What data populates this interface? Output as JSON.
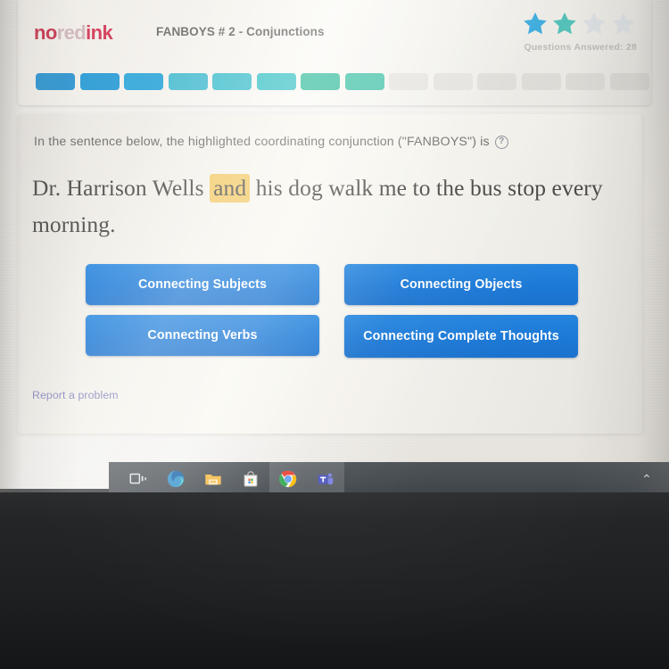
{
  "app": {
    "logo": {
      "part1": "no",
      "part2": "red",
      "part3": "ink"
    },
    "quiz_title": "FANBOYS # 2 - Conjunctions"
  },
  "score": {
    "questions_answered_label": "Questions Answered: 28",
    "stars_total": 4,
    "stars_filled": 2,
    "star_colors": [
      "#35a8db",
      "#4dbdb5",
      "#d9dde0",
      "#d9dde0"
    ]
  },
  "progress": {
    "total_segments": 14,
    "filled_segments": 8,
    "segment_colors": [
      "#2e94cf",
      "#2a9bd4",
      "#2fa6d8",
      "#49bcd0",
      "#45c0cd",
      "#40c3c6",
      "#3dbfa0",
      "#42c2a8",
      "#e5e3de",
      "#e3e1dc",
      "#dedcd7",
      "#dcdad5",
      "#dad8d3",
      "#d8d6d1"
    ]
  },
  "question": {
    "prompt": "In the sentence below, the highlighted coordinating conjunction (\"FANBOYS\") is",
    "help_icon_glyph": "?",
    "sentence_before": "Dr. Harrison Wells ",
    "sentence_highlight": "and",
    "sentence_after": " his dog walk me to the bus stop every morning.",
    "highlight_color": "#f2c964"
  },
  "answers": [
    {
      "label": "Connecting Subjects"
    },
    {
      "label": "Connecting Objects"
    },
    {
      "label": "Connecting Verbs"
    },
    {
      "label": "Connecting Complete Thoughts"
    }
  ],
  "answer_button_color": "#1c79d6",
  "footer": {
    "report_link": "Report a problem"
  },
  "taskbar": {
    "items": [
      {
        "name": "task-view",
        "active": false
      },
      {
        "name": "microsoft-edge",
        "active": false
      },
      {
        "name": "file-explorer",
        "active": false
      },
      {
        "name": "microsoft-store",
        "active": false
      },
      {
        "name": "google-chrome",
        "active": true
      },
      {
        "name": "microsoft-teams",
        "active": true
      }
    ],
    "show_hidden_icons_glyph": "⌃"
  }
}
